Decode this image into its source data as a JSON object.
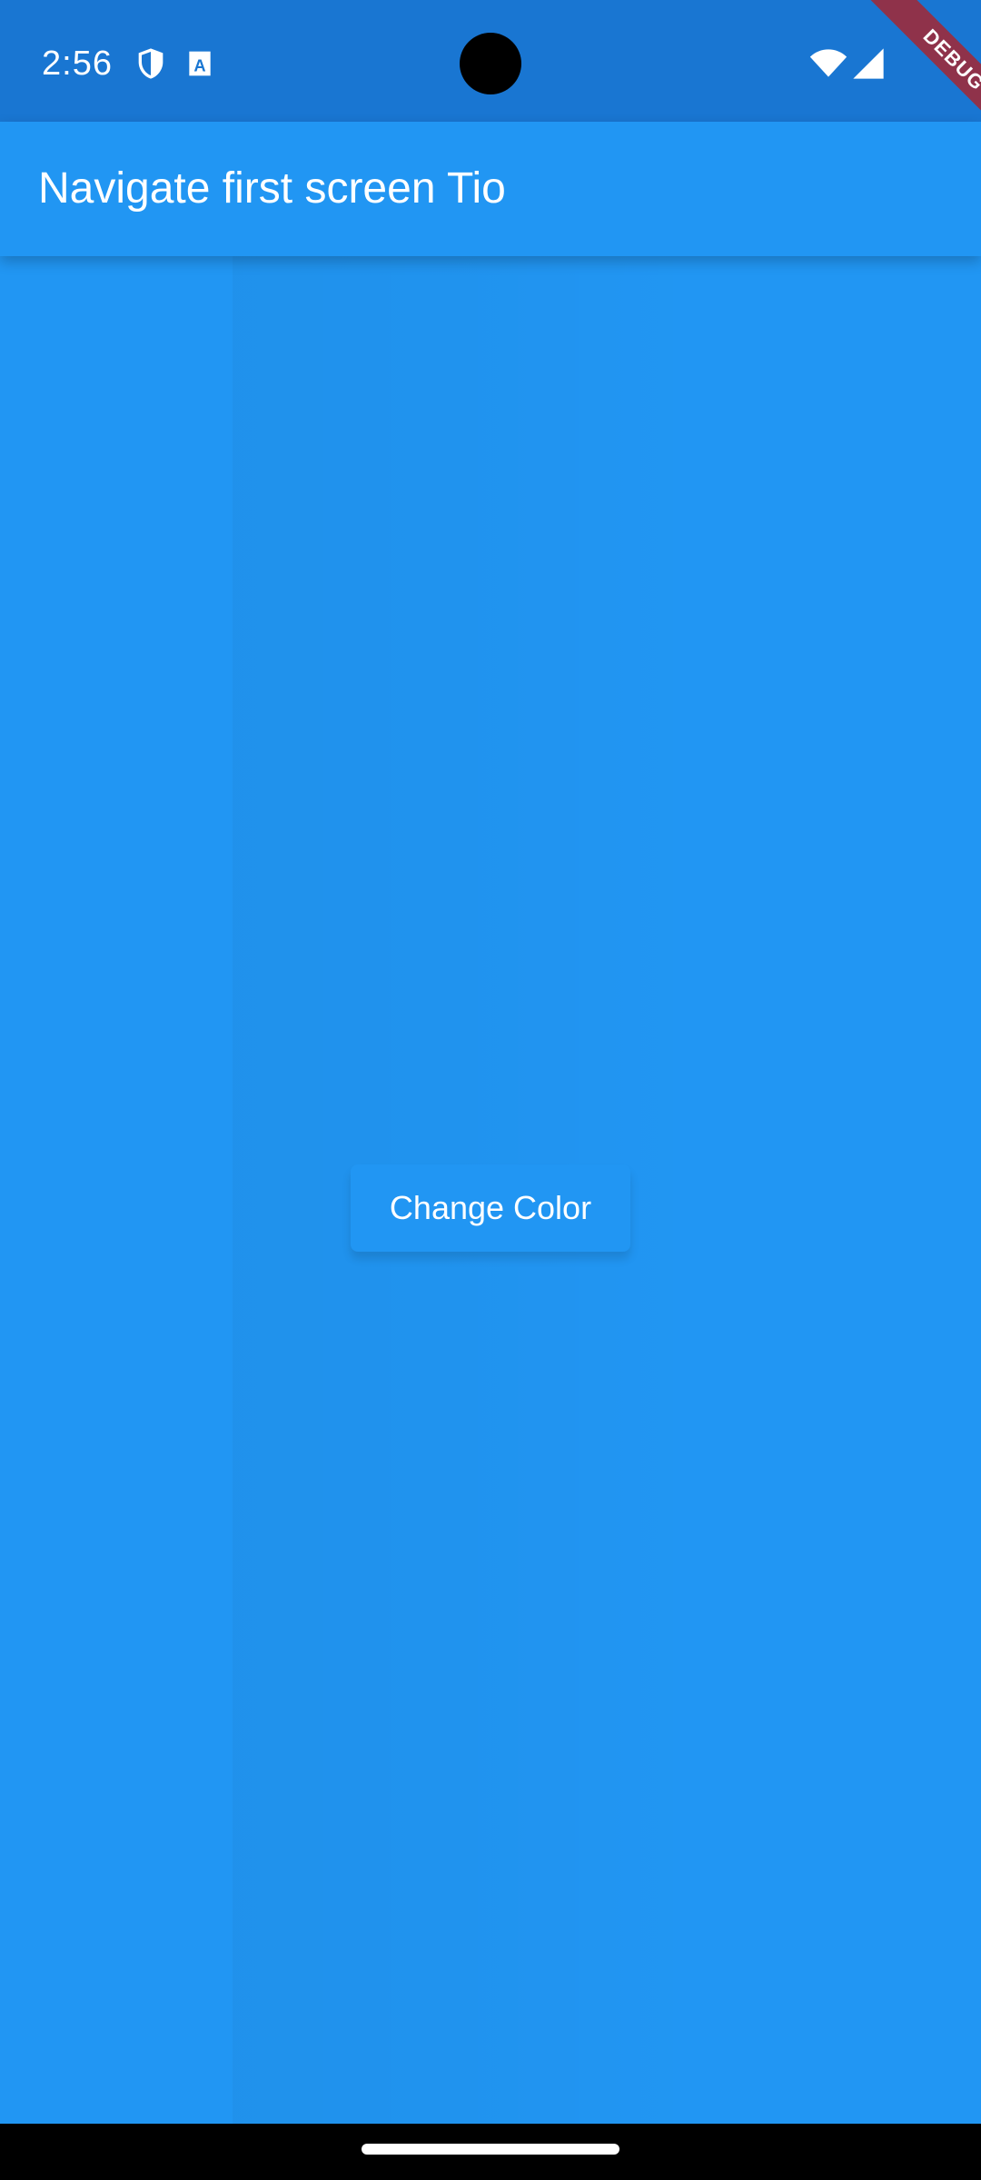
{
  "status_bar": {
    "time": "2:56",
    "icons": [
      "shield-icon",
      "keyboard-a-icon",
      "wifi-icon",
      "cell-signal-icon"
    ]
  },
  "debug_banner": {
    "label": "DEBUG"
  },
  "app_bar": {
    "title": "Navigate first screen Tio"
  },
  "main": {
    "button_label": "Change Color"
  },
  "colors": {
    "primary": "#2196F3",
    "status_bar": "#1976D2",
    "debug": "#B71C1C"
  }
}
